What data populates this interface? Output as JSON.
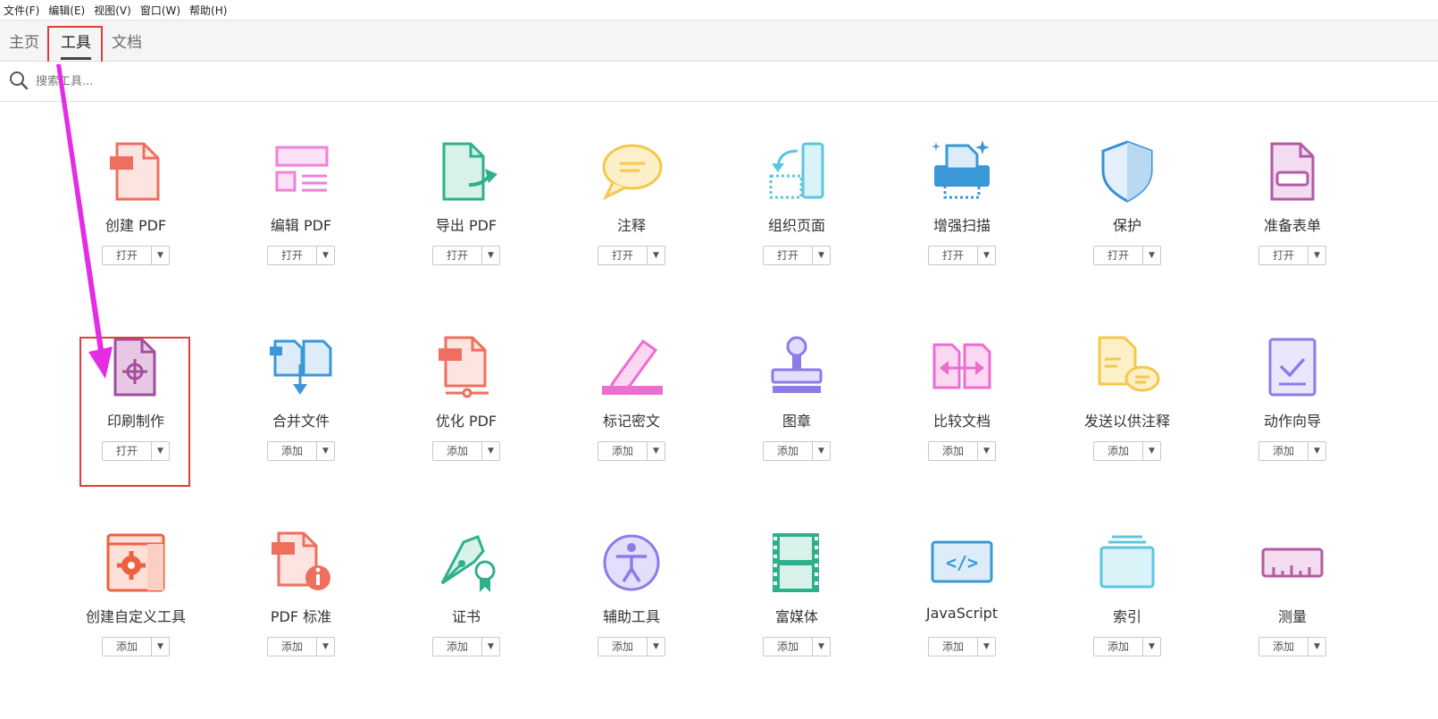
{
  "menu": [
    "文件(F)",
    "编辑(E)",
    "视图(V)",
    "窗口(W)",
    "帮助(H)"
  ],
  "tabs": [
    {
      "label": "主页",
      "active": false
    },
    {
      "label": "工具",
      "active": true
    },
    {
      "label": "文档",
      "active": false
    }
  ],
  "search": {
    "placeholder": "搜索工具..."
  },
  "tools": [
    {
      "name": "创建 PDF",
      "button": "打开",
      "icon": "create-pdf-icon",
      "color": "#ef6f5f"
    },
    {
      "name": "编辑 PDF",
      "button": "打开",
      "icon": "edit-pdf-icon",
      "color": "#ee82d6"
    },
    {
      "name": "导出 PDF",
      "button": "打开",
      "icon": "export-pdf-icon",
      "color": "#2fb08c"
    },
    {
      "name": "注释",
      "button": "打开",
      "icon": "comment-icon",
      "color": "#f5c84a"
    },
    {
      "name": "组织页面",
      "button": "打开",
      "icon": "organize-pages-icon",
      "color": "#5cc6dd"
    },
    {
      "name": "增强扫描",
      "button": "打开",
      "icon": "enhance-scan-icon",
      "color": "#3b98d6"
    },
    {
      "name": "保护",
      "button": "打开",
      "icon": "shield-icon",
      "color": "#3a8fd6"
    },
    {
      "name": "准备表单",
      "button": "打开",
      "icon": "prepare-form-icon",
      "color": "#b35aa6"
    },
    {
      "name": "印刷制作",
      "button": "打开",
      "icon": "print-production-icon",
      "color": "#a04f9c"
    },
    {
      "name": "合并文件",
      "button": "添加",
      "icon": "combine-files-icon",
      "color": "#3b98d6"
    },
    {
      "name": "优化 PDF",
      "button": "添加",
      "icon": "optimize-pdf-icon",
      "color": "#ef6f5f"
    },
    {
      "name": "标记密文",
      "button": "添加",
      "icon": "redact-icon",
      "color": "#ee6dd0"
    },
    {
      "name": "图章",
      "button": "添加",
      "icon": "stamp-icon",
      "color": "#8a7de8"
    },
    {
      "name": "比较文档",
      "button": "添加",
      "icon": "compare-icon",
      "color": "#ee6dd0"
    },
    {
      "name": "发送以供注释",
      "button": "添加",
      "icon": "send-for-comments-icon",
      "color": "#f5c84a"
    },
    {
      "name": "动作向导",
      "button": "添加",
      "icon": "action-wizard-icon",
      "color": "#8a7de8"
    },
    {
      "name": "创建自定义工具",
      "button": "添加",
      "icon": "custom-tool-icon",
      "color": "#ef6040"
    },
    {
      "name": "PDF 标准",
      "button": "添加",
      "icon": "pdf-standards-icon",
      "color": "#ef6f5f"
    },
    {
      "name": "证书",
      "button": "添加",
      "icon": "certificate-icon",
      "color": "#2fb08c"
    },
    {
      "name": "辅助工具",
      "button": "添加",
      "icon": "accessibility-icon",
      "color": "#8a7de8"
    },
    {
      "name": "富媒体",
      "button": "添加",
      "icon": "rich-media-icon",
      "color": "#2fb08c"
    },
    {
      "name": "JavaScript",
      "button": "添加",
      "icon": "javascript-icon",
      "color": "#3b98d6"
    },
    {
      "name": "索引",
      "button": "添加",
      "icon": "index-icon",
      "color": "#5cc6dd"
    },
    {
      "name": "测量",
      "button": "添加",
      "icon": "measure-icon",
      "color": "#b35aa6"
    }
  ],
  "colors": {
    "highlight": "#e23b3b",
    "arrow": "#e52ce5"
  }
}
